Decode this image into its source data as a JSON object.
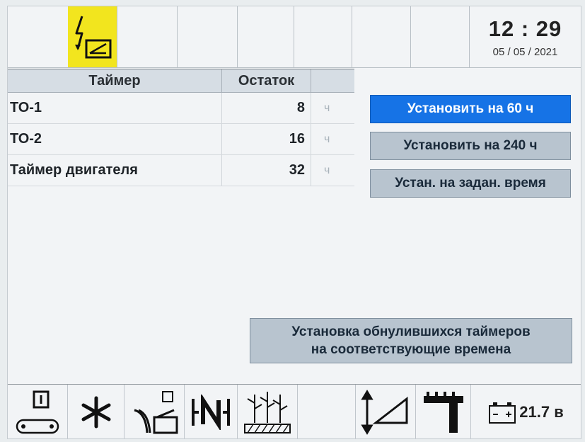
{
  "header": {
    "time": "12 : 29",
    "date": "05 / 05 / 2021",
    "icons": [
      "lightning-warning-icon"
    ]
  },
  "table": {
    "col_timer": "Таймер",
    "col_remaining": "Остаток",
    "rows": [
      {
        "name": "ТО-1",
        "value": "8",
        "unit": "ч"
      },
      {
        "name": "ТО-2",
        "value": "16",
        "unit": "ч"
      },
      {
        "name": "Таймер двигателя",
        "value": "32",
        "unit": "ч"
      }
    ]
  },
  "buttons": {
    "set60": "Установить на 60 ч",
    "set240": "Установить на 240 ч",
    "set_custom": "Устан. на задан. время",
    "reset_line1": "Установка обнулившихся таймеров",
    "reset_line2": "на соответствующие времена"
  },
  "footer": {
    "icons": [
      "conveyor-icon",
      "fan-icon",
      "unloading-icon",
      "neutral-gear-icon",
      "crop-icon",
      "blank",
      "header-height-icon",
      "cutter-bar-icon",
      "battery-icon"
    ],
    "battery_voltage": "21.7 в"
  },
  "colors": {
    "warning": "#f2e51e",
    "active_button": "#1673e6",
    "button": "#b8c4cf"
  }
}
